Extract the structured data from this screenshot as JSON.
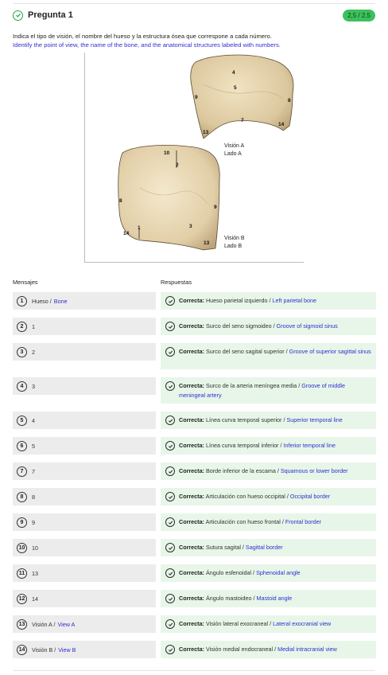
{
  "question": {
    "title": "Pregunta 1",
    "score": "2,5 / 2,5",
    "instruction_es": "Indica el tipo de visión, el nombre del hueso y la estructura ósea que correspone a cada número.",
    "instruction_en": "Identify the point of view, the name of the bone, and the anatomical structures labeled with numbers."
  },
  "figure": {
    "view_a": {
      "line1": "Visión A",
      "line2": "Lado A"
    },
    "view_b": {
      "line1": "Visión B",
      "line2": "Lado B"
    },
    "labels_a": [
      "4",
      "5",
      "9",
      "8",
      "7",
      "13",
      "14"
    ],
    "labels_b": [
      "10",
      "2",
      "8",
      "9",
      "3",
      "1",
      "14",
      "13"
    ]
  },
  "columns": {
    "messages": "Mensajes",
    "answers": "Respuestas"
  },
  "rows": [
    {
      "num": "1",
      "msg_es": "Hueso /",
      "msg_en": "Bone",
      "status": "Correcta:",
      "ans_es": "Hueso parietal izquierdo /",
      "ans_en": "Left parietal bone"
    },
    {
      "num": "2",
      "msg_es": "1",
      "msg_en": "",
      "status": "Correcta:",
      "ans_es": "Surco del seno sigmoideo /",
      "ans_en": "Groove of sigmoid sinus"
    },
    {
      "num": "3",
      "msg_es": "2",
      "msg_en": "",
      "status": "Correcta:",
      "ans_es": "Surco del seno sagital superior /",
      "ans_en": "Groove of superior sagittal sinus"
    },
    {
      "num": "4",
      "msg_es": "3",
      "msg_en": "",
      "status": "Correcta:",
      "ans_es": "Surco de la arteria meníngea media /",
      "ans_en": "Groove of middle meningeal artery"
    },
    {
      "num": "5",
      "msg_es": "4",
      "msg_en": "",
      "status": "Correcta:",
      "ans_es": "Línea curva temporal superior /",
      "ans_en": "Superior temporal line"
    },
    {
      "num": "6",
      "msg_es": "5",
      "msg_en": "",
      "status": "Correcta:",
      "ans_es": "Línea curva temporal inferior /",
      "ans_en": "Inferior temporal line"
    },
    {
      "num": "7",
      "msg_es": "7",
      "msg_en": "",
      "status": "Correcta:",
      "ans_es": "Borde inferior de la escama /",
      "ans_en": "Squamous or lower border"
    },
    {
      "num": "8",
      "msg_es": "8",
      "msg_en": "",
      "status": "Correcta:",
      "ans_es": "Articulación con hueso occipital /",
      "ans_en": "Occipital border"
    },
    {
      "num": "9",
      "msg_es": "9",
      "msg_en": "",
      "status": "Correcta:",
      "ans_es": "Articulación con hueso frontal /",
      "ans_en": "Frontal border"
    },
    {
      "num": "10",
      "msg_es": "10",
      "msg_en": "",
      "status": "Correcta:",
      "ans_es": "Sutura sagital /",
      "ans_en": "Sagittal border"
    },
    {
      "num": "11",
      "msg_es": "13",
      "msg_en": "",
      "status": "Correcta:",
      "ans_es": "Ángulo esfenoidal /",
      "ans_en": "Sphenoidal angle"
    },
    {
      "num": "12",
      "msg_es": "14",
      "msg_en": "",
      "status": "Correcta:",
      "ans_es": "Ángulo mastoideo /",
      "ans_en": "Mastoid angle"
    },
    {
      "num": "13",
      "msg_es": "Visión A /",
      "msg_en": "View A",
      "status": "Correcta:",
      "ans_es": "Visión lateral exocraneal /",
      "ans_en": "Lateral exocranial view"
    },
    {
      "num": "14",
      "msg_es": "Visión B /",
      "msg_en": "View B",
      "status": "Correcta:",
      "ans_es": "Visión medial endocraneal /",
      "ans_en": "Medial intracranial view"
    }
  ],
  "colors": {
    "correct_green": "#3cc15d",
    "answer_bg": "#e7f6e8",
    "english_blue": "#2f2fd2"
  }
}
